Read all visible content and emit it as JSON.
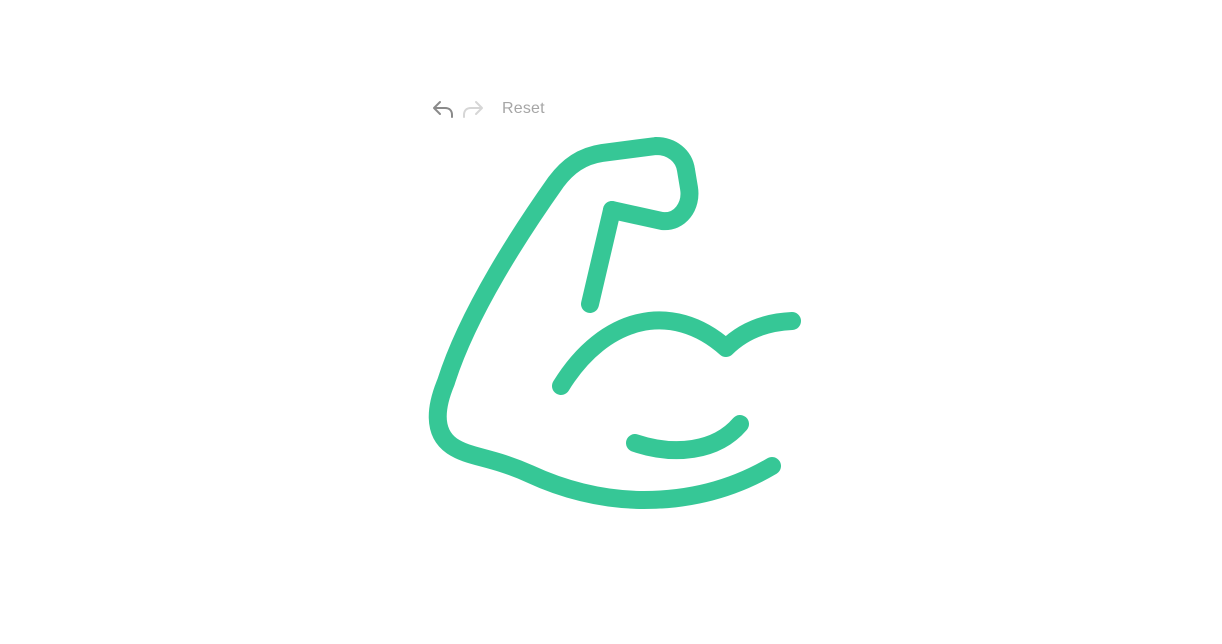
{
  "toolbar": {
    "undo_icon": "undo-icon",
    "redo_icon": "redo-icon",
    "reset_label": "Reset",
    "undo_color": "#8a8a8a",
    "redo_color": "#d6d6d6"
  },
  "drawing": {
    "subject": "flexed-arm-icon",
    "stroke_color": "#36c796"
  }
}
